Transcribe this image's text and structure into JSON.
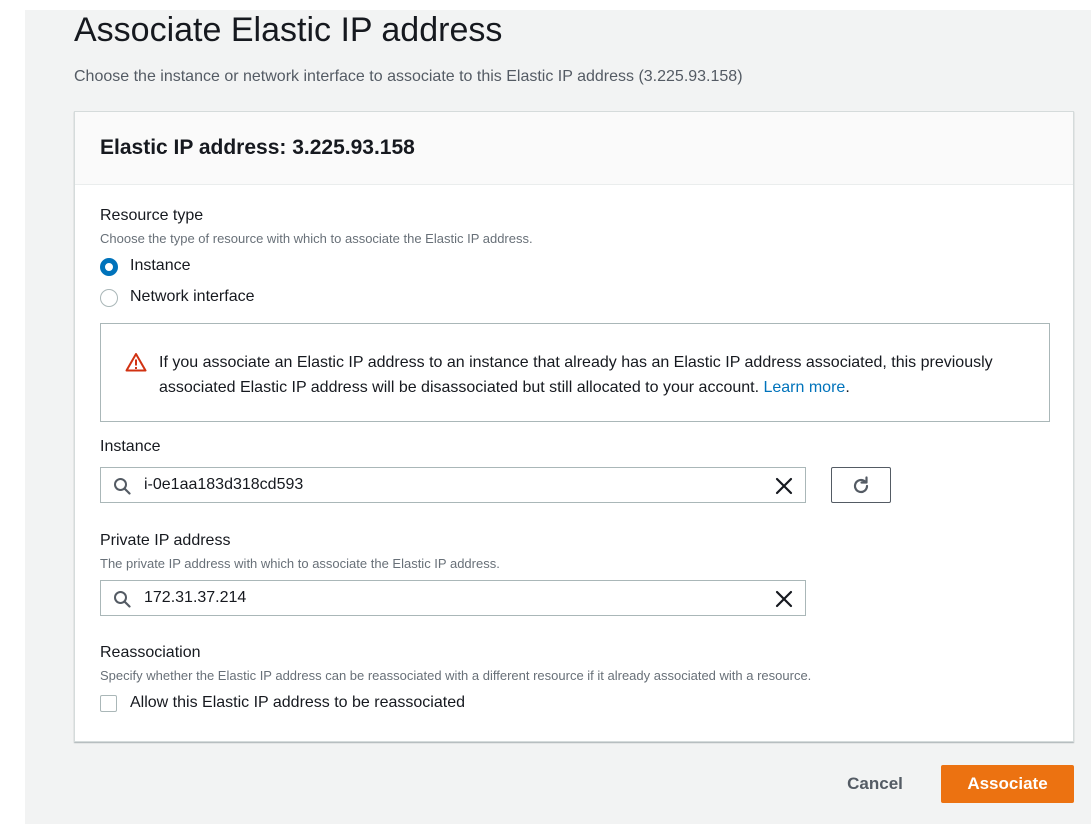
{
  "page": {
    "title": "Associate Elastic IP address",
    "description": "Choose the instance or network interface to associate to this Elastic IP address (3.225.93.158)"
  },
  "panel": {
    "title": "Elastic IP address: 3.225.93.158"
  },
  "resource_type": {
    "label": "Resource type",
    "description": "Choose the type of resource with which to associate the Elastic IP address.",
    "options": [
      {
        "label": "Instance",
        "selected": true
      },
      {
        "label": "Network interface",
        "selected": false
      }
    ]
  },
  "alert": {
    "icon": "warning-triangle-icon",
    "text": "If you associate an Elastic IP address to an instance that already has an Elastic IP address associated, this previously associated Elastic IP address will be disassociated but still allocated to your account.",
    "link": "Learn more",
    "trailing": ".",
    "color": "#d13212"
  },
  "instance": {
    "label": "Instance",
    "value": "i-0e1aa183d318cd593"
  },
  "private_ip": {
    "label": "Private IP address",
    "description": "The private IP address with which to associate the Elastic IP address.",
    "value": "172.31.37.214"
  },
  "reassociation": {
    "label": "Reassociation",
    "description": "Specify whether the Elastic IP address can be reassociated with a different resource if it already associated with a resource.",
    "checkbox_label": "Allow this Elastic IP address to be reassociated",
    "checked": false
  },
  "footer": {
    "cancel_label": "Cancel",
    "submit_label": "Associate",
    "accent": "#ec7211"
  }
}
